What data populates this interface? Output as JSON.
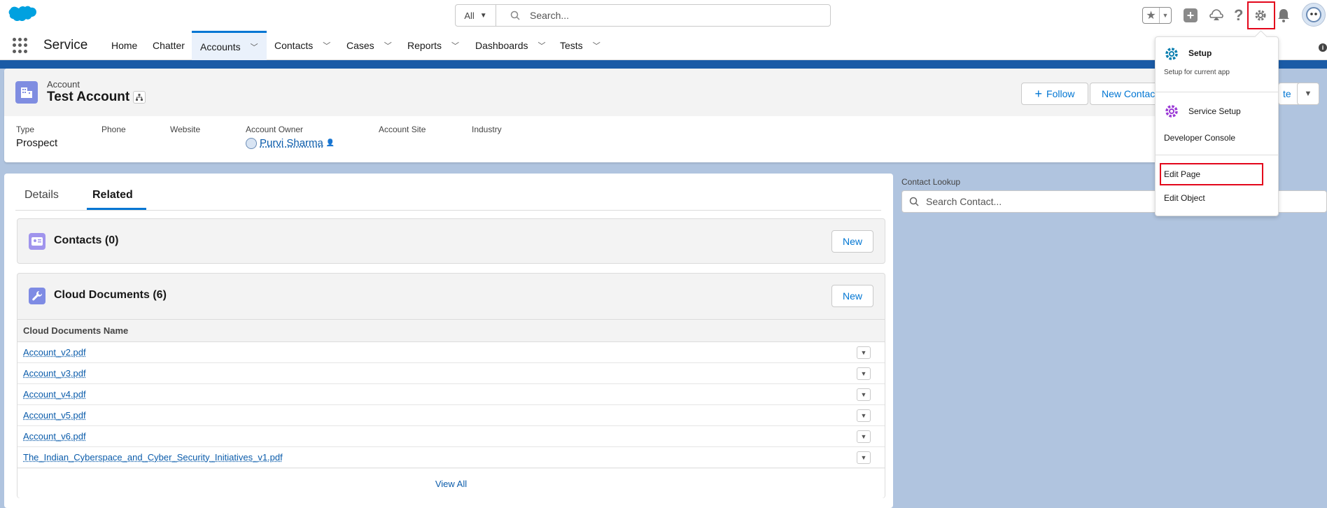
{
  "header": {
    "search_scope": "All",
    "search_placeholder": "Search..."
  },
  "nav": {
    "app_name": "Service",
    "items": [
      {
        "label": "Home",
        "has_menu": false
      },
      {
        "label": "Chatter",
        "has_menu": false
      },
      {
        "label": "Accounts",
        "has_menu": true,
        "active": true
      },
      {
        "label": "Contacts",
        "has_menu": true
      },
      {
        "label": "Cases",
        "has_menu": true
      },
      {
        "label": "Reports",
        "has_menu": true
      },
      {
        "label": "Dashboards",
        "has_menu": true
      },
      {
        "label": "Tests",
        "has_menu": true
      }
    ]
  },
  "record": {
    "object_label": "Account",
    "name": "Test Account",
    "actions": {
      "follow": "Follow",
      "new_contact": "New Contact",
      "partial": "te"
    },
    "fields": [
      {
        "label": "Type",
        "value": "Prospect"
      },
      {
        "label": "Phone",
        "value": ""
      },
      {
        "label": "Website",
        "value": ""
      },
      {
        "label": "Account Owner",
        "value": "Purvi Sharma"
      },
      {
        "label": "Account Site",
        "value": ""
      },
      {
        "label": "Industry",
        "value": ""
      }
    ]
  },
  "tabs": {
    "details": "Details",
    "related": "Related"
  },
  "related": {
    "contacts": {
      "title": "Contacts (0)",
      "new_label": "New"
    },
    "cloud_docs": {
      "title": "Cloud Documents (6)",
      "new_label": "New",
      "column": "Cloud Documents Name",
      "rows": [
        "Account_v2.pdf",
        "Account_v3.pdf",
        "Account_v4.pdf",
        "Account_v5.pdf",
        "Account_v6.pdf",
        "The_Indian_Cyberspace_and_Cyber_Security_Initiatives_v1.pdf"
      ],
      "view_all": "View All"
    }
  },
  "lookup": {
    "label": "Contact Lookup",
    "placeholder": "Search Contact..."
  },
  "setup_menu": {
    "setup": "Setup",
    "setup_sub": "Setup for current app",
    "service_setup": "Service Setup",
    "developer_console": "Developer Console",
    "edit_page": "Edit Page",
    "edit_object": "Edit Object"
  },
  "colors": {
    "brand": "#0176d3",
    "highlight": "#e3061b",
    "nav_strip": "#1b5ba6"
  }
}
